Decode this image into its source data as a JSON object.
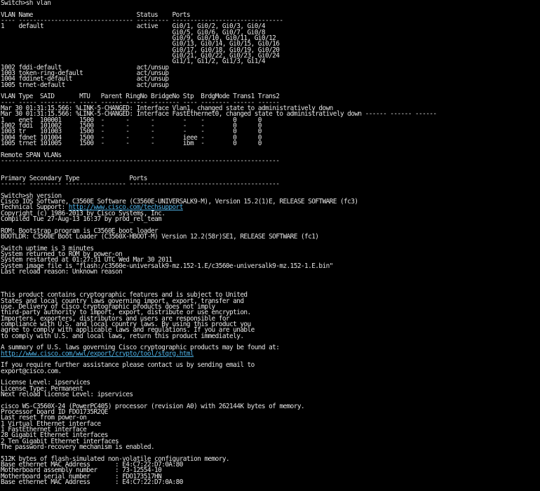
{
  "colors": {
    "background": "#000000",
    "text": "#e6e6e6",
    "link": "#4fb3e8"
  },
  "terminal": {
    "lines": [
      "Switch>sh vlan",
      "",
      "VLAN Name                             Status    Ports",
      "---- -------------------------------- --------- -------------------------------",
      "1    default                          active    Gi0/1, Gi0/2, Gi0/3, Gi0/4",
      "                                                Gi0/5, Gi0/6, Gi0/7, Gi0/8",
      "                                                Gi0/9, Gi0/10, Gi0/11, Gi0/12",
      "                                                Gi0/13, Gi0/14, Gi0/15, Gi0/16",
      "                                                Gi0/17, Gi0/18, Gi0/19, Gi0/20",
      "                                                Gi0/21, Gi0/22, Gi0/23, Gi0/24",
      "                                                Gi1/1, Gi1/2, Gi1/3, Gi1/4",
      "1002 fddi-default                     act/unsup",
      "1003 token-ring-default               act/unsup",
      "1004 fddinet-default                  act/unsup",
      "1005 trnet-default                    act/unsup",
      "",
      "VLAN Type  SAID       MTU   Parent RingNo BridgeNo Stp  BrdgMode Trans1 Trans2",
      "---- ----- ---------- ----- ------ ------ -------- ---- -------- ------ ------",
      "Mar 30 01:31:15.566: %LINK-5-CHANGED: Interface Vlan1, changed state to administratively down",
      "Mar 30 01:31:15.566: %LINK-5-CHANGED: Interface FastEthernet0, changed state to administratively down ------ ------ ------",
      "1    enet  100001     1500  -      -      -        -    -        0      0",
      "1002 fddi  101002     1500  -      -      -        -    -        0      0",
      "1003 tr    101003     1500  -      -      -        -    -        0      0",
      "1004 fdnet 101004     1500  -      -      -        ieee -        0      0",
      "1005 trnet 101005     1500  -      -      -        ibm  -        0      0",
      "",
      "Remote SPAN VLANs",
      "------------------------------------------------------------------------------",
      "",
      "",
      "Primary Secondary Type              Ports",
      "------- --------- ----------------- ------------------------------------------",
      "",
      "Switch>sh version",
      "Cisco IOS Software, C3560E Software (C3560E-UNIVERSALK9-M), Version 15.2(1)E, RELEASE SOFTWARE (fc3)",
      "Technical Support: {{link1}}",
      "Copyright (c) 1986-2013 by Cisco Systems, Inc.",
      "Compiled Tue 27-Aug-13 16:37 by prod_rel_team",
      "",
      "ROM: Bootstrap program is C3560E boot loader",
      "BOOTLDR: C3560E Boot Loader (C3560X-HBOOT-M) Version 12.2(58r)SE1, RELEASE SOFTWARE (fc1)",
      "",
      "Switch uptime is 3 minutes",
      "System returned to ROM by power-on",
      "System restarted at 01:27:31 UTC Wed Mar 30 2011",
      "System image file is \"flash:/c3560e-universalk9-mz.152-1.E/c3560e-universalk9-mz.152-1.E.bin\"",
      "Last reload reason: Unknown reason",
      "",
      "",
      "",
      "This product contains cryptographic features and is subject to United",
      "States and local country laws governing import, export, transfer and",
      "use. Delivery of Cisco cryptographic products does not imply",
      "third-party authority to import, export, distribute or use encryption.",
      "Importers, exporters, distributors and users are responsible for",
      "compliance with U.S. and local country laws. By using this product you",
      "agree to comply with applicable laws and regulations. If you are unable",
      "to comply with U.S. and local laws, return this product immediately.",
      "",
      "A summary of U.S. laws governing Cisco cryptographic products may be found at:",
      "{{link2}}",
      "",
      "If you require further assistance please contact us by sending email to",
      "export@cisco.com.",
      "",
      "License Level: ipservices",
      "License Type: Permanent",
      "Next reload license Level: ipservices",
      "",
      "cisco WS-C3560X-24 (PowerPC405) processor (revision A0) with 262144K bytes of memory.",
      "Processor board ID FDO1735R2QE",
      "Last reset from power-on",
      "1 Virtual Ethernet interface",
      "1 FastEthernet interface",
      "28 Gigabit Ethernet interfaces",
      "2 Ten Gigabit Ethernet interfaces",
      "The password-recovery mechanism is enabled.",
      "",
      "512K bytes of flash-simulated non-volatile configuration memory.",
      "Base ethernet MAC Address       : E4:C7:22:D7:0A:80",
      "Motherboard assembly number     : 73-12554-10",
      "Motherboard serial number       : FDO173517HN",
      "Base ethernet MAC Address       : E4:C7:22:D7:0A:80"
    ],
    "links": {
      "link1": "http://www.cisco.com/techsupport",
      "link2": "http://www.cisco.com/wwl/export/crypto/tool/stqrg.html"
    }
  }
}
